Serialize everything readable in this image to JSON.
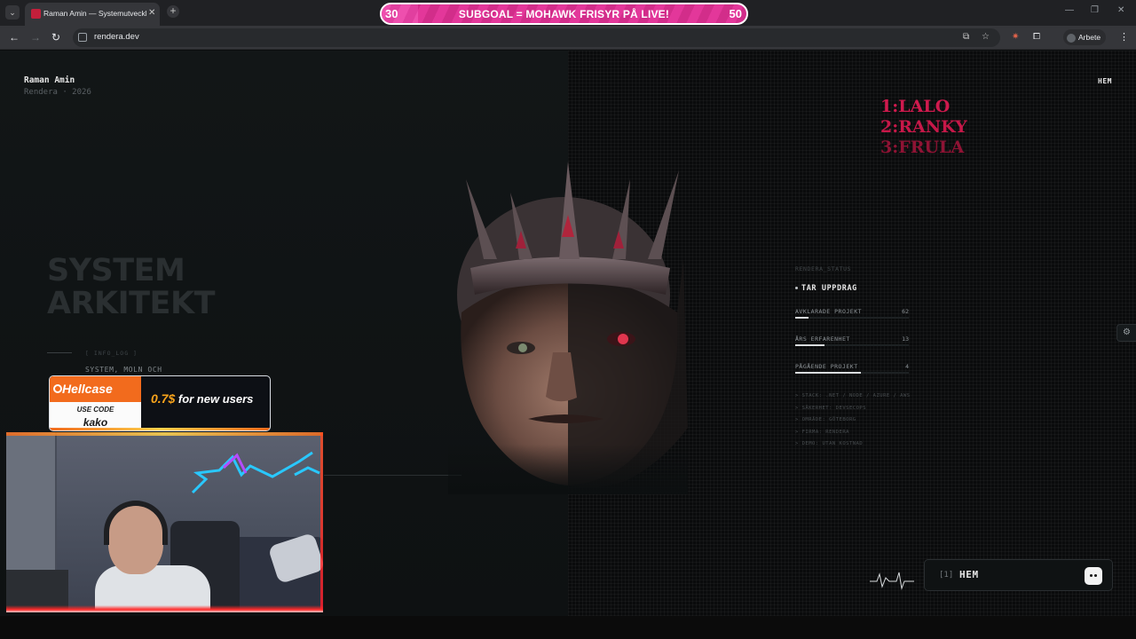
{
  "browser": {
    "tab_title": "Raman Amin — Systemutveckla",
    "url": "rendera.dev",
    "profile_name": "Arbete",
    "window_controls": [
      "—",
      "❐",
      "✕"
    ]
  },
  "overlay": {
    "subgoal": {
      "start": "30",
      "text": "SUBGOAL = MOHAWK FRISYR PÅ LIVE!",
      "end": "50",
      "progress_fraction": 0.1
    },
    "leaderboard": [
      "1:LALO",
      "2:RANKY",
      "3:FRULA"
    ],
    "sponsor": {
      "brand": "Hellcase",
      "code_label": "USE CODE",
      "code": "kako",
      "offer_amount": "0.7$",
      "offer_text": " for new users"
    }
  },
  "site": {
    "name": "Raman Amin",
    "subtitle": "Rendera · 2026",
    "nav_home": "HEM",
    "hero_title_line1": "SYSTEM",
    "hero_title_line2": "ARKITEKT",
    "info_log": "[ INFO_LOG ]",
    "info_desc": "SYSTEM, MOLN OCH",
    "status": {
      "label": "RENDERA_STATUS",
      "state": "TAR UPPDRAG",
      "stats": [
        {
          "label": "AVKLARADE PROJEKT",
          "value": "62",
          "fraction": 0.12
        },
        {
          "label": "ÅRS ERFARENHET",
          "value": "13",
          "fraction": 0.26
        },
        {
          "label": "PÅGÅENDE PROJEKT",
          "value": "4",
          "fraction": 0.58
        }
      ],
      "details": [
        "> STACK: .NET / NODE / AZURE / AWS",
        "> SÄKERHET: DEVSECOPS",
        "> OMRÅDE: GÖTEBORG",
        "> FIRMA: RENDERA",
        "> DEMO: UTAN KOSTNAD"
      ]
    },
    "terminal": {
      "index": "[1]",
      "label": "HEM"
    }
  },
  "colors": {
    "accent": "#d01a4e",
    "subgoal_pink": "#e3379a",
    "sponsor_orange": "#f26b1d"
  }
}
